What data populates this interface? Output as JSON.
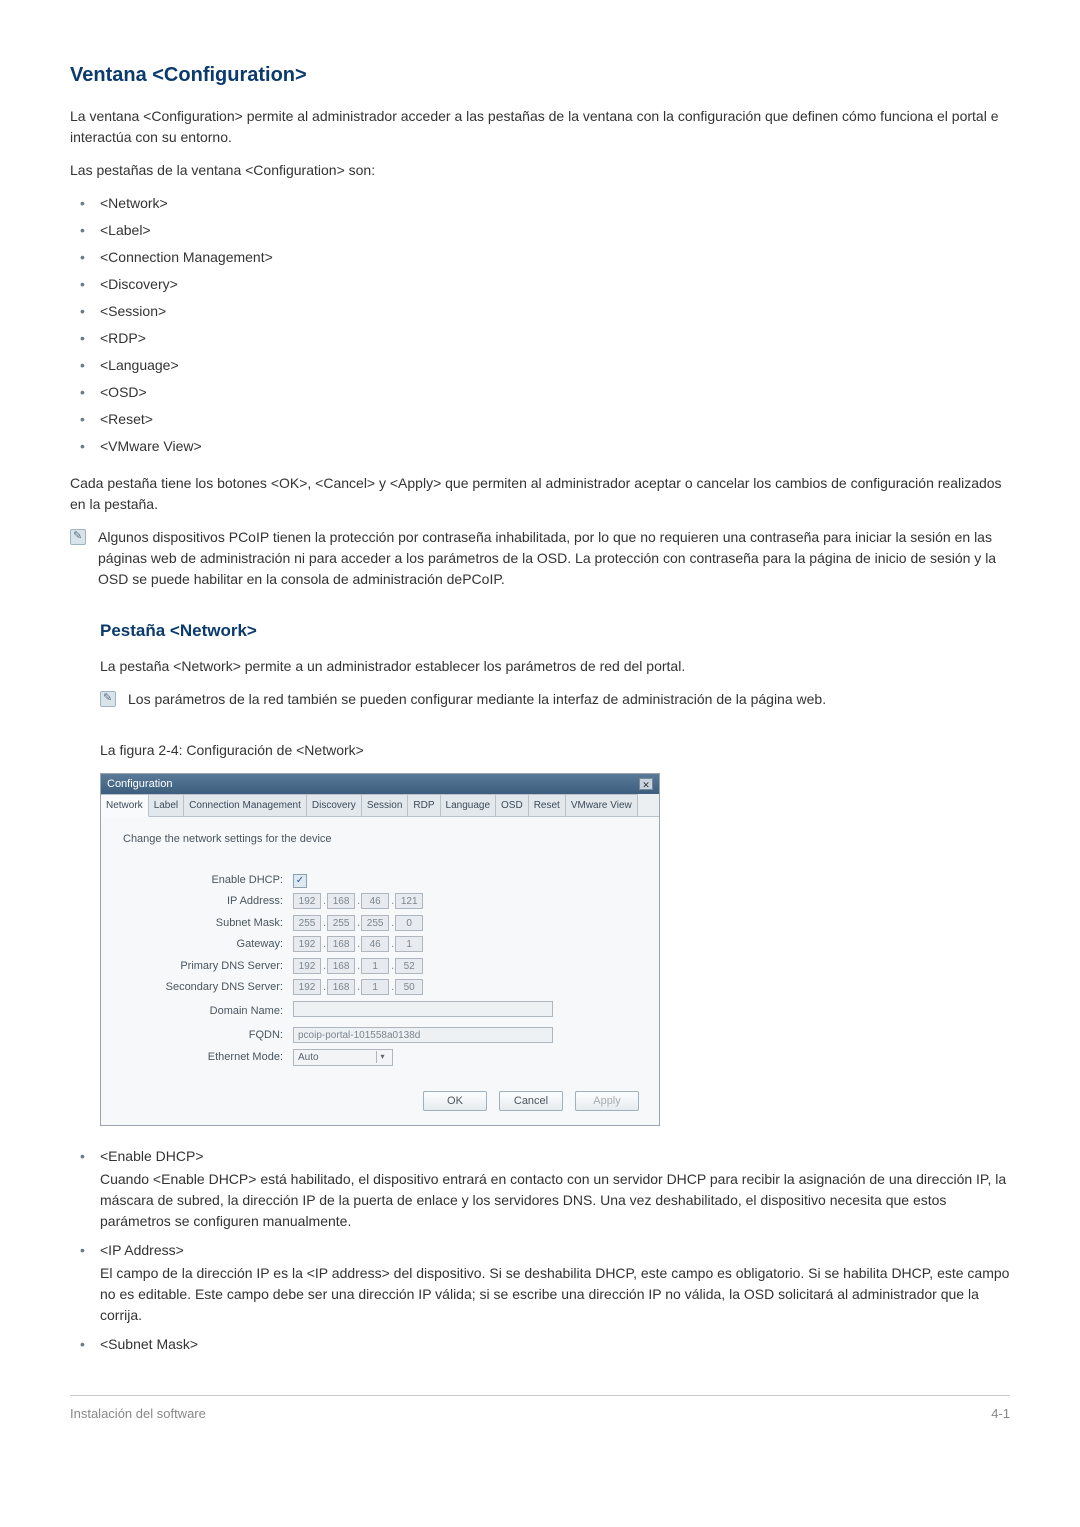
{
  "title": "Ventana <Configuration>",
  "intro_p1": "La ventana <Configuration> permite al administrador acceder a las pestañas de la ventana con la configuración que definen cómo funciona el portal e interactúa con su entorno.",
  "intro_p2": "Las pestañas de la ventana <Configuration> son:",
  "tabs_list": [
    "<Network>",
    "<Label>",
    "<Connection Management>",
    "<Discovery>",
    "<Session>",
    "<RDP>",
    "<Language>",
    "<OSD>",
    "<Reset>",
    "<VMware View>"
  ],
  "after_list_p": "Cada pestaña tiene los botones <OK>, <Cancel> y <Apply> que permiten al administrador aceptar o cancelar los cambios de configuración realizados en la pestaña.",
  "note1": "Algunos dispositivos PCoIP tienen la protección por contraseña inhabilitada, por lo que no requieren una contraseña para iniciar la sesión en las páginas web de administración ni para acceder a los parámetros de la OSD. La protección con contraseña para la página de inicio de sesión y la OSD se puede habilitar en la consola de administración dePCoIP.",
  "network_section": {
    "title": "Pestaña <Network>",
    "p1": "La pestaña <Network> permite a un administrador establecer los parámetros de red del portal.",
    "note": "Los parámetros de la red también se pueden configurar mediante la interfaz de administración de la página web.",
    "figure_caption": "La figura 2-4: Configuración de <Network>"
  },
  "config_window": {
    "title": "Configuration",
    "tabs": [
      "Network",
      "Label",
      "Connection Management",
      "Discovery",
      "Session",
      "RDP",
      "Language",
      "OSD",
      "Reset",
      "VMware View"
    ],
    "active_tab_index": 0,
    "instruction": "Change the network settings for the device",
    "fields": {
      "enable_dhcp_label": "Enable DHCP:",
      "enable_dhcp_checked": "✓",
      "ip_address_label": "IP Address:",
      "ip_address": [
        "192",
        "168",
        "46",
        "121"
      ],
      "subnet_mask_label": "Subnet Mask:",
      "subnet_mask": [
        "255",
        "255",
        "255",
        "0"
      ],
      "gateway_label": "Gateway:",
      "gateway": [
        "192",
        "168",
        "46",
        "1"
      ],
      "primary_dns_label": "Primary DNS Server:",
      "primary_dns": [
        "192",
        "168",
        "1",
        "52"
      ],
      "secondary_dns_label": "Secondary DNS Server:",
      "secondary_dns": [
        "192",
        "168",
        "1",
        "50"
      ],
      "domain_name_label": "Domain Name:",
      "domain_name_value": "",
      "fqdn_label": "FQDN:",
      "fqdn_value": "pcoip-portal-101558a0138d",
      "ethernet_mode_label": "Ethernet Mode:",
      "ethernet_mode_value": "Auto"
    },
    "buttons": {
      "ok": "OK",
      "cancel": "Cancel",
      "apply": "Apply"
    }
  },
  "definitions": [
    {
      "term": "<Enable DHCP>",
      "desc": "Cuando <Enable DHCP> está habilitado, el dispositivo entrará en contacto con un servidor DHCP para recibir la asignación de una dirección IP, la máscara de subred, la dirección IP de la puerta de enlace y los servidores DNS. Una vez deshabilitado, el dispositivo necesita que estos parámetros se configuren manualmente."
    },
    {
      "term": "<IP Address>",
      "desc": "El campo de la dirección IP es la <IP address> del dispositivo. Si se deshabilita DHCP, este campo es obligatorio. Si se habilita DHCP, este campo no es editable. Este campo debe ser una dirección IP válida; si se escribe una dirección IP no válida, la OSD solicitará al administrador que la corrija."
    },
    {
      "term": "<Subnet Mask>",
      "desc": ""
    }
  ],
  "footer": {
    "left": "Instalación del software",
    "right": "4-1"
  }
}
